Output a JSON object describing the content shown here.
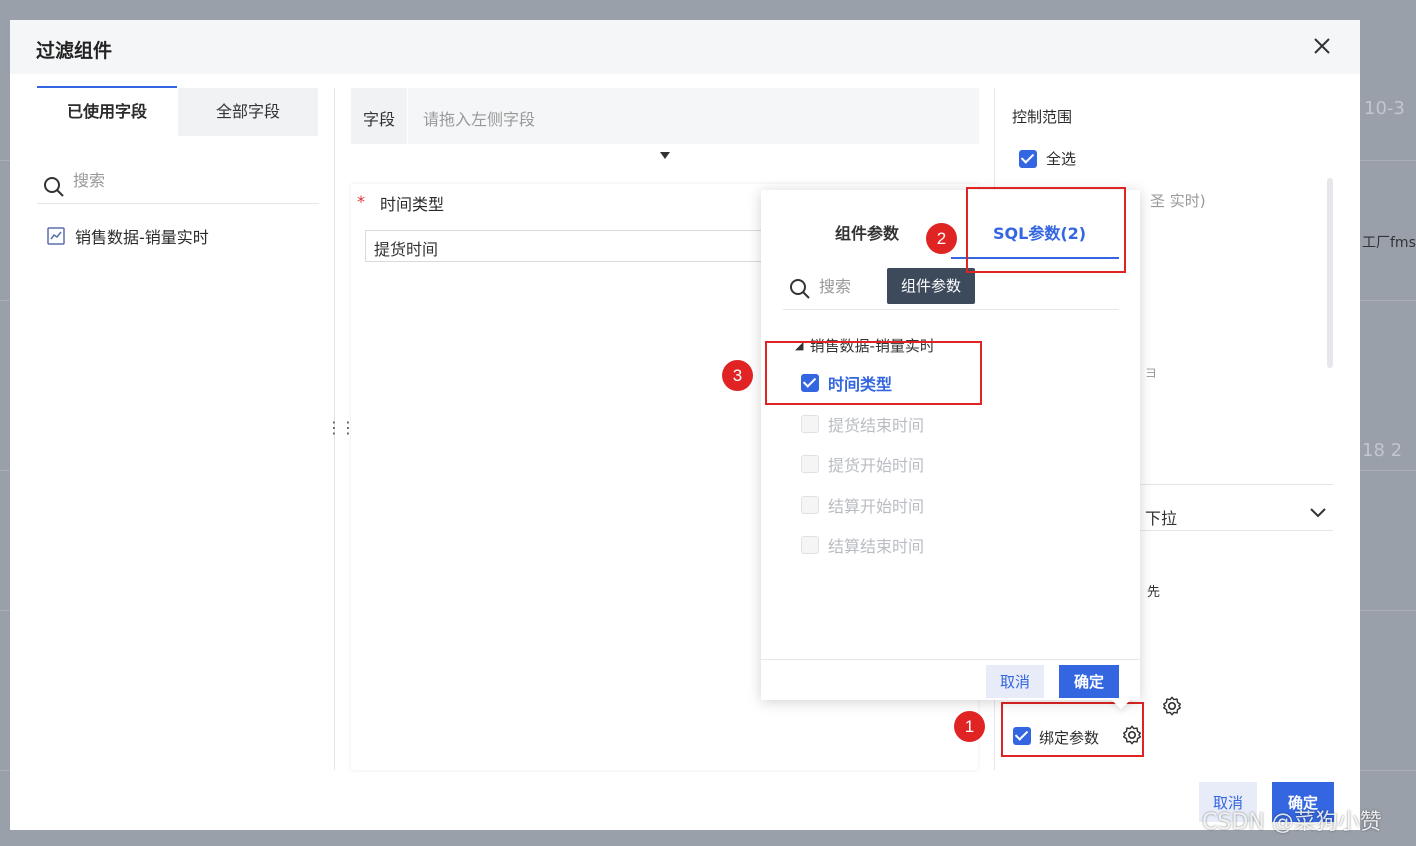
{
  "background": {
    "fragments": [
      "10-3",
      "工厂fms",
      "18 2"
    ]
  },
  "dialog": {
    "title": "过滤组件",
    "tabs": [
      {
        "label": "已使用字段",
        "active": true
      },
      {
        "label": "全部字段",
        "active": false
      }
    ],
    "search_placeholder": "搜索",
    "datasets": [
      {
        "label": "销售数据-销量实时",
        "icon": "chart-icon"
      }
    ],
    "field_label": "字段",
    "field_placeholder": "请拖入左侧字段",
    "required_label": "时间类型",
    "selected_value": "提货时间",
    "right": {
      "title": "控制范围",
      "select_all": "全选",
      "fragment_top": "圣 实时)",
      "fragment_mid": "ヨ",
      "dropdown_text": "下拉",
      "fragment_small": "先",
      "bind_label": "绑定参数"
    },
    "footer": {
      "cancel": "取消",
      "ok": "确定"
    }
  },
  "popover": {
    "tabs": [
      {
        "label": "组件参数",
        "active": false
      },
      {
        "label": "SQL参数(2)",
        "active": true
      }
    ],
    "search_placeholder": "搜索",
    "tooltip": "组件参数",
    "group_label": "销售数据-销量实时",
    "items": [
      {
        "label": "时间类型",
        "checked": true,
        "disabled": false
      },
      {
        "label": "提货结束时间",
        "checked": false,
        "disabled": true
      },
      {
        "label": "提货开始时间",
        "checked": false,
        "disabled": true
      },
      {
        "label": "结算开始时间",
        "checked": false,
        "disabled": true
      },
      {
        "label": "结算结束时间",
        "checked": false,
        "disabled": true
      }
    ],
    "cancel": "取消",
    "ok": "确定"
  },
  "annotations": {
    "marker1": "1",
    "marker2": "2",
    "marker3": "3"
  },
  "watermark": "CSDN @菜狗小赞",
  "colors": {
    "accent": "#3366e0",
    "annotation_red": "#e02424",
    "tooltip_bg": "#3c4a5c"
  }
}
